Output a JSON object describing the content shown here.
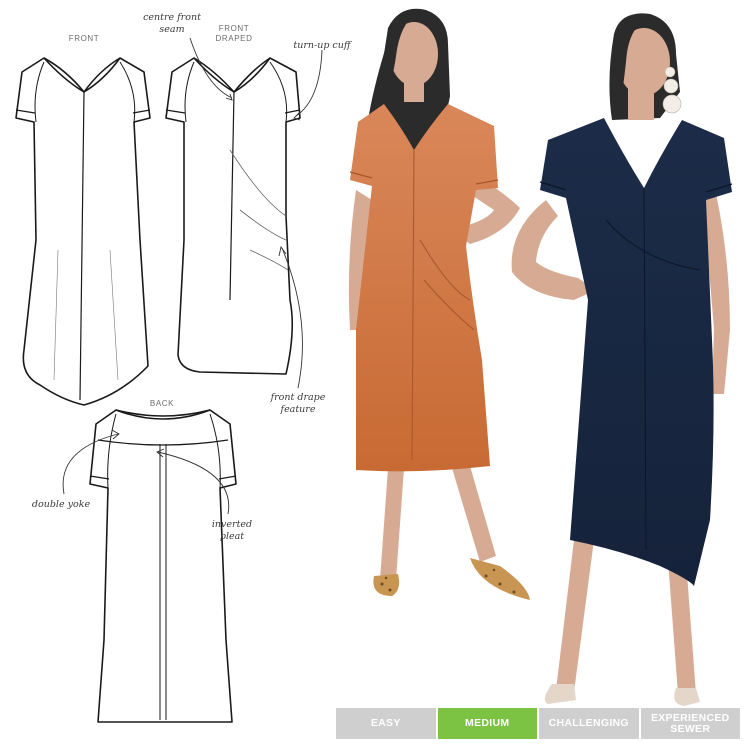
{
  "sketch_labels": {
    "front": "FRONT",
    "front_draped_line1": "FRONT",
    "front_draped_line2": "DRAPED",
    "back": "BACK"
  },
  "callouts": {
    "centre_front_seam_line1": "centre front",
    "centre_front_seam_line2": "seam",
    "turn_up_cuff": "turn-up cuff",
    "front_drape_line1": "front drape",
    "front_drape_line2": "feature",
    "double_yoke": "double yoke",
    "inverted_pleat_line1": "inverted",
    "inverted_pleat_line2": "pleat"
  },
  "difficulty": {
    "selected": "MEDIUM",
    "levels": [
      {
        "label_line1": "EASY",
        "label_line2": "",
        "color": "#cfcfcf"
      },
      {
        "label_line1": "MEDIUM",
        "label_line2": "",
        "color": "#7cc243"
      },
      {
        "label_line1": "CHALLENGING",
        "label_line2": "",
        "color": "#cfcfcf"
      },
      {
        "label_line1": "EXPERIENCED",
        "label_line2": "SEWER",
        "color": "#cfcfcf"
      }
    ]
  },
  "colors": {
    "orange_dress": "#cd7845",
    "navy_dress": "#1b2b46",
    "skin": "#d7ab93",
    "hair": "#2b2b2b",
    "shoe_leopard": "#c89552",
    "shoe_nude": "#e4d6c8"
  }
}
